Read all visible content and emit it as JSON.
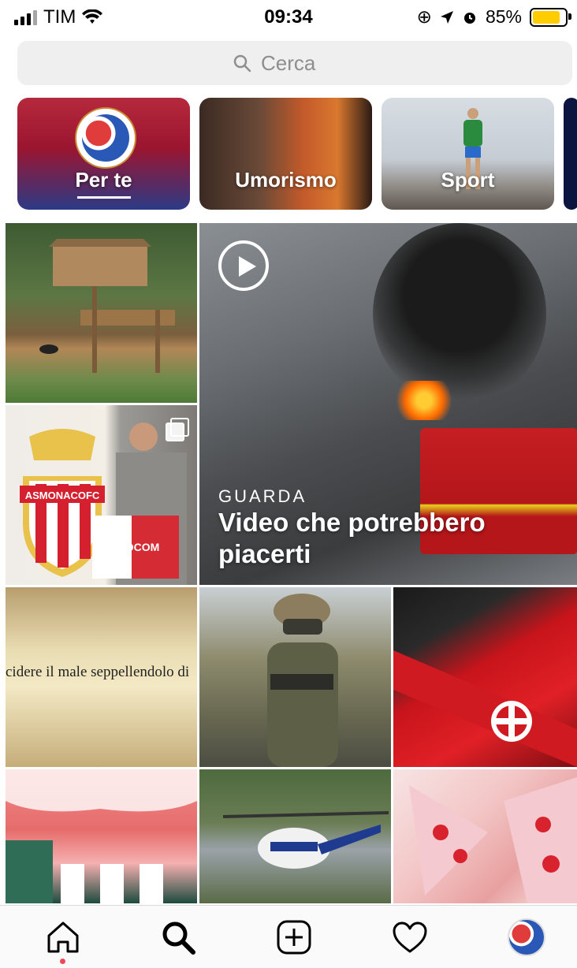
{
  "status_bar": {
    "carrier": "TIM",
    "time": "09:34",
    "battery": "85%",
    "battery_level": 0.85,
    "battery_color": "#ffcc00"
  },
  "search": {
    "placeholder": "Cerca"
  },
  "categories": [
    {
      "label": "Per te",
      "selected": true
    },
    {
      "label": "Umorismo",
      "selected": false
    },
    {
      "label": "Sport",
      "selected": false
    }
  ],
  "grid": {
    "video": {
      "watch_label": "GUARDA",
      "title": "Video che potrebbero piacerti"
    },
    "monaco": {
      "crest_text": "ASMONACOFC",
      "shirt_text": "FEDCOM"
    },
    "text_post": {
      "quote": "cidere il male seppellendolo di"
    }
  },
  "tabbar": {
    "items": [
      "home-icon",
      "search-icon",
      "add-icon",
      "heart-icon",
      "profile-avatar"
    ],
    "active": "home-icon",
    "notification_color": "#ed4956"
  }
}
